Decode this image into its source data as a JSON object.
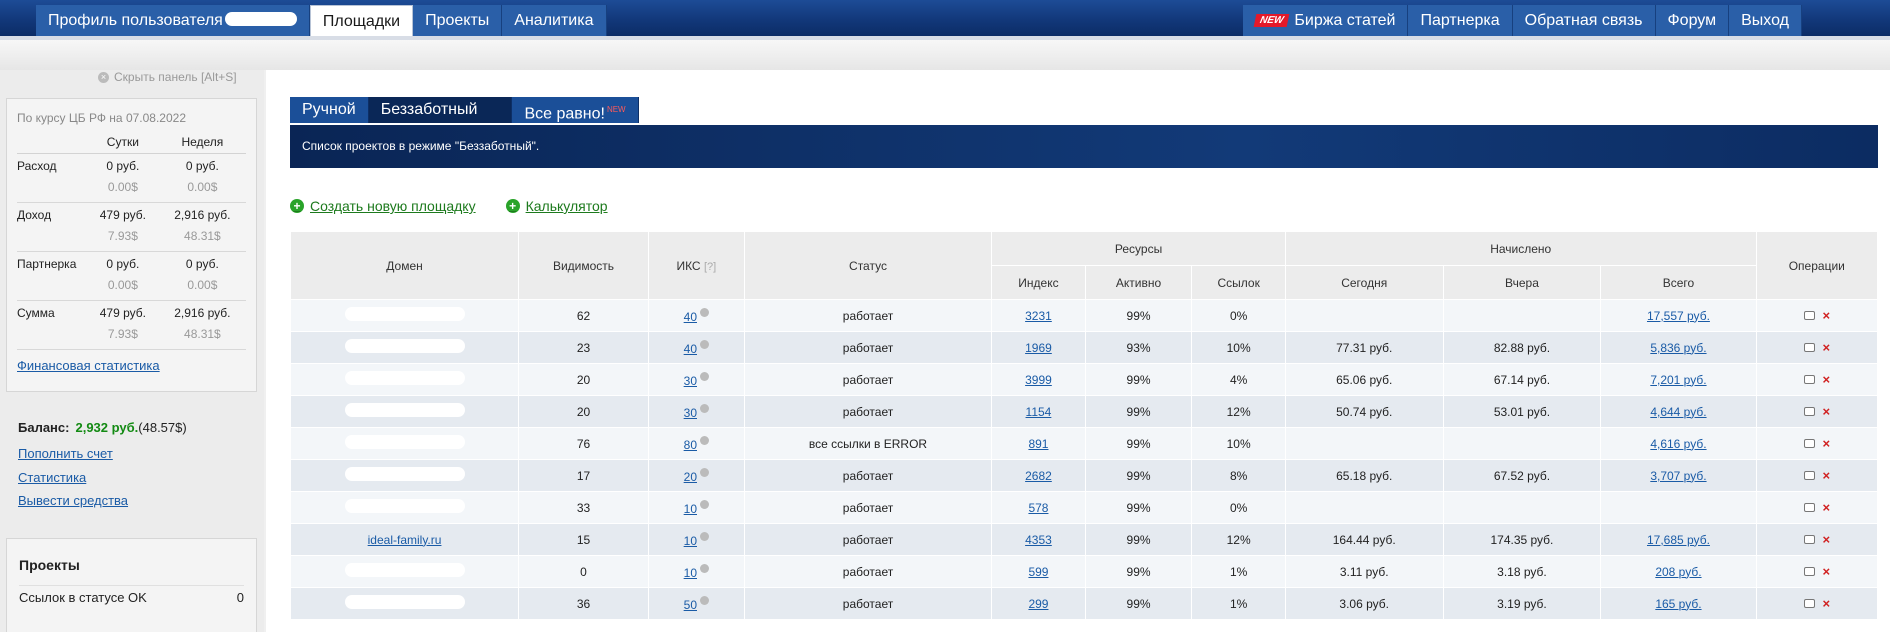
{
  "topnav": {
    "left": [
      {
        "label": "Профиль пользователя",
        "active": false,
        "redacted": true
      },
      {
        "label": "Площадки",
        "active": true
      },
      {
        "label": "Проекты",
        "active": false
      },
      {
        "label": "Аналитика",
        "active": false
      }
    ],
    "right": [
      {
        "label": "Биржа статей",
        "badge": "NEW"
      },
      {
        "label": "Партнерка"
      },
      {
        "label": "Обратная связь"
      },
      {
        "label": "Форум"
      },
      {
        "label": "Выход"
      }
    ]
  },
  "sidebar": {
    "hide_panel": "Скрыть панель [Alt+S]",
    "rate_caption": "По курсу ЦБ РФ на 07.08.2022",
    "col_day": "Сутки",
    "col_week": "Неделя",
    "rows": [
      {
        "label": "Расход",
        "day_rub": "0 руб.",
        "week_rub": "0 руб.",
        "day_usd": "0.00$",
        "week_usd": "0.00$"
      },
      {
        "label": "Доход",
        "day_rub": "479 руб.",
        "week_rub": "2,916 руб.",
        "day_usd": "7.93$",
        "week_usd": "48.31$"
      },
      {
        "label": "Партнерка",
        "day_rub": "0 руб.",
        "week_rub": "0 руб.",
        "day_usd": "0.00$",
        "week_usd": "0.00$"
      },
      {
        "label": "Сумма",
        "day_rub": "479 руб.",
        "week_rub": "2,916 руб.",
        "day_usd": "7.93$",
        "week_usd": "48.31$"
      }
    ],
    "fin_stats_link": "Финансовая статистика",
    "balance_label": "Баланс:",
    "balance_rub": "2,932 руб.",
    "balance_usd": "(48.57$)",
    "links": [
      "Пополнить счет",
      "Статистика",
      "Вывести средства"
    ],
    "projects_title": "Проекты",
    "projects_row_label": "Ссылок в статусе OK",
    "projects_row_value": "0"
  },
  "tabs": [
    {
      "label": "Ручной",
      "active": false
    },
    {
      "label": "Беззаботный",
      "active": true
    },
    {
      "label": "Все равно!",
      "sup": "NEW",
      "active": false
    }
  ],
  "mode_text": "Список проектов в режиме \"Беззаботный\".",
  "actions": {
    "create": "Создать новую площадку",
    "calculator": "Калькулятор"
  },
  "table": {
    "headers": {
      "domain": "Домен",
      "visibility": "Видимость",
      "iks": "ИКС",
      "iks_help": "[?]",
      "status": "Статус",
      "resources": "Ресурсы",
      "accrued": "Начислено",
      "operations": "Операции",
      "index": "Индекс",
      "active": "Активно",
      "links": "Ссылок",
      "today": "Сегодня",
      "yesterday": "Вчера",
      "total": "Всего"
    },
    "rows": [
      {
        "domain": "",
        "visibility": "62",
        "iks": "40",
        "status": "работает",
        "index": "3231",
        "active": "99%",
        "links": "0%",
        "today": "",
        "yesterday": "",
        "total": "17,557 руб."
      },
      {
        "domain": "",
        "visibility": "23",
        "iks": "40",
        "status": "работает",
        "index": "1969",
        "active": "93%",
        "links": "10%",
        "today": "77.31 руб.",
        "yesterday": "82.88 руб.",
        "total": "5,836 руб."
      },
      {
        "domain": "",
        "visibility": "20",
        "iks": "30",
        "status": "работает",
        "index": "3999",
        "active": "99%",
        "links": "4%",
        "today": "65.06 руб.",
        "yesterday": "67.14 руб.",
        "total": "7,201 руб."
      },
      {
        "domain": "",
        "visibility": "20",
        "iks": "30",
        "status": "работает",
        "index": "1154",
        "active": "99%",
        "links": "12%",
        "today": "50.74 руб.",
        "yesterday": "53.01 руб.",
        "total": "4,644 руб."
      },
      {
        "domain": "",
        "visibility": "76",
        "iks": "80",
        "status": "все ссылки в ERROR",
        "index": "891",
        "active": "99%",
        "links": "10%",
        "today": "",
        "yesterday": "",
        "total": "4,616 руб."
      },
      {
        "domain": "",
        "visibility": "17",
        "iks": "20",
        "status": "работает",
        "index": "2682",
        "active": "99%",
        "links": "8%",
        "today": "65.18 руб.",
        "yesterday": "67.52 руб.",
        "total": "3,707 руб."
      },
      {
        "domain": "",
        "visibility": "33",
        "iks": "10",
        "status": "работает",
        "index": "578",
        "active": "99%",
        "links": "0%",
        "today": "",
        "yesterday": "",
        "total": ""
      },
      {
        "domain": "ideal-family.ru",
        "visibility": "15",
        "iks": "10",
        "status": "работает",
        "index": "4353",
        "active": "99%",
        "links": "12%",
        "today": "164.44 руб.",
        "yesterday": "174.35 руб.",
        "total": "17,685 руб."
      },
      {
        "domain": "",
        "visibility": "0",
        "iks": "10",
        "status": "работает",
        "index": "599",
        "active": "99%",
        "links": "1%",
        "today": "3.11 руб.",
        "yesterday": "3.18 руб.",
        "total": "208 руб."
      },
      {
        "domain": "",
        "visibility": "36",
        "iks": "50",
        "status": "работает",
        "index": "299",
        "active": "99%",
        "links": "1%",
        "today": "3.06 руб.",
        "yesterday": "3.19 руб.",
        "total": "165 руб."
      }
    ]
  },
  "colors": {
    "topbar": "#12387a",
    "balance_value": "#138a13",
    "link": "#1a5ba6",
    "delete": "#d02020"
  }
}
